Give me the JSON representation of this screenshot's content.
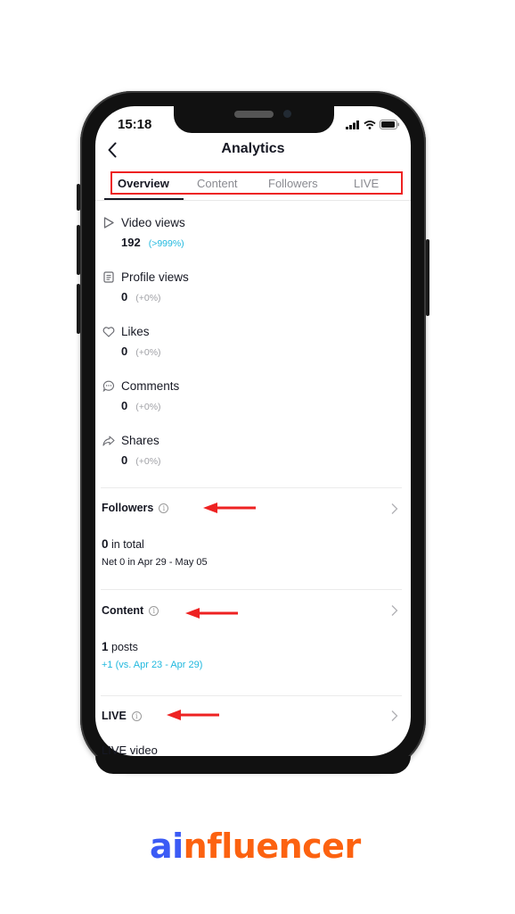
{
  "status_bar": {
    "time": "15:18"
  },
  "header": {
    "title": "Analytics",
    "back_icon": "chevron-left-icon"
  },
  "tabs": [
    {
      "label": "Overview",
      "active": true
    },
    {
      "label": "Content",
      "active": false
    },
    {
      "label": "Followers",
      "active": false
    },
    {
      "label": "LIVE",
      "active": false
    }
  ],
  "metrics": [
    {
      "icon": "play-icon",
      "label": "Video views",
      "value": "192",
      "delta": "(>999%)",
      "delta_positive": true
    },
    {
      "icon": "profile-card-icon",
      "label": "Profile views",
      "value": "0",
      "delta": "(+0%)",
      "delta_positive": false
    },
    {
      "icon": "heart-icon",
      "label": "Likes",
      "value": "0",
      "delta": "(+0%)",
      "delta_positive": false
    },
    {
      "icon": "comment-icon",
      "label": "Comments",
      "value": "0",
      "delta": "(+0%)",
      "delta_positive": false
    },
    {
      "icon": "share-icon",
      "label": "Shares",
      "value": "0",
      "delta": "(+0%)",
      "delta_positive": false
    }
  ],
  "sections": {
    "followers": {
      "title": "Followers",
      "value": "0",
      "value_suffix": " in total",
      "sub": "Net 0 in Apr 29 - May 05"
    },
    "content": {
      "title": "Content",
      "value": "1",
      "value_suffix": " posts",
      "sub": "+1 (vs. Apr 23 - Apr 29)"
    },
    "live": {
      "title": "LIVE",
      "partial_text": "LIVE video"
    }
  },
  "colors": {
    "accent_blue": "#20b8de",
    "annotation_red": "#ee2222",
    "brand_blue": "#3b5bf5",
    "brand_orange": "#fc6210"
  },
  "brand": {
    "part1": "ai",
    "part2": "nfluencer"
  }
}
